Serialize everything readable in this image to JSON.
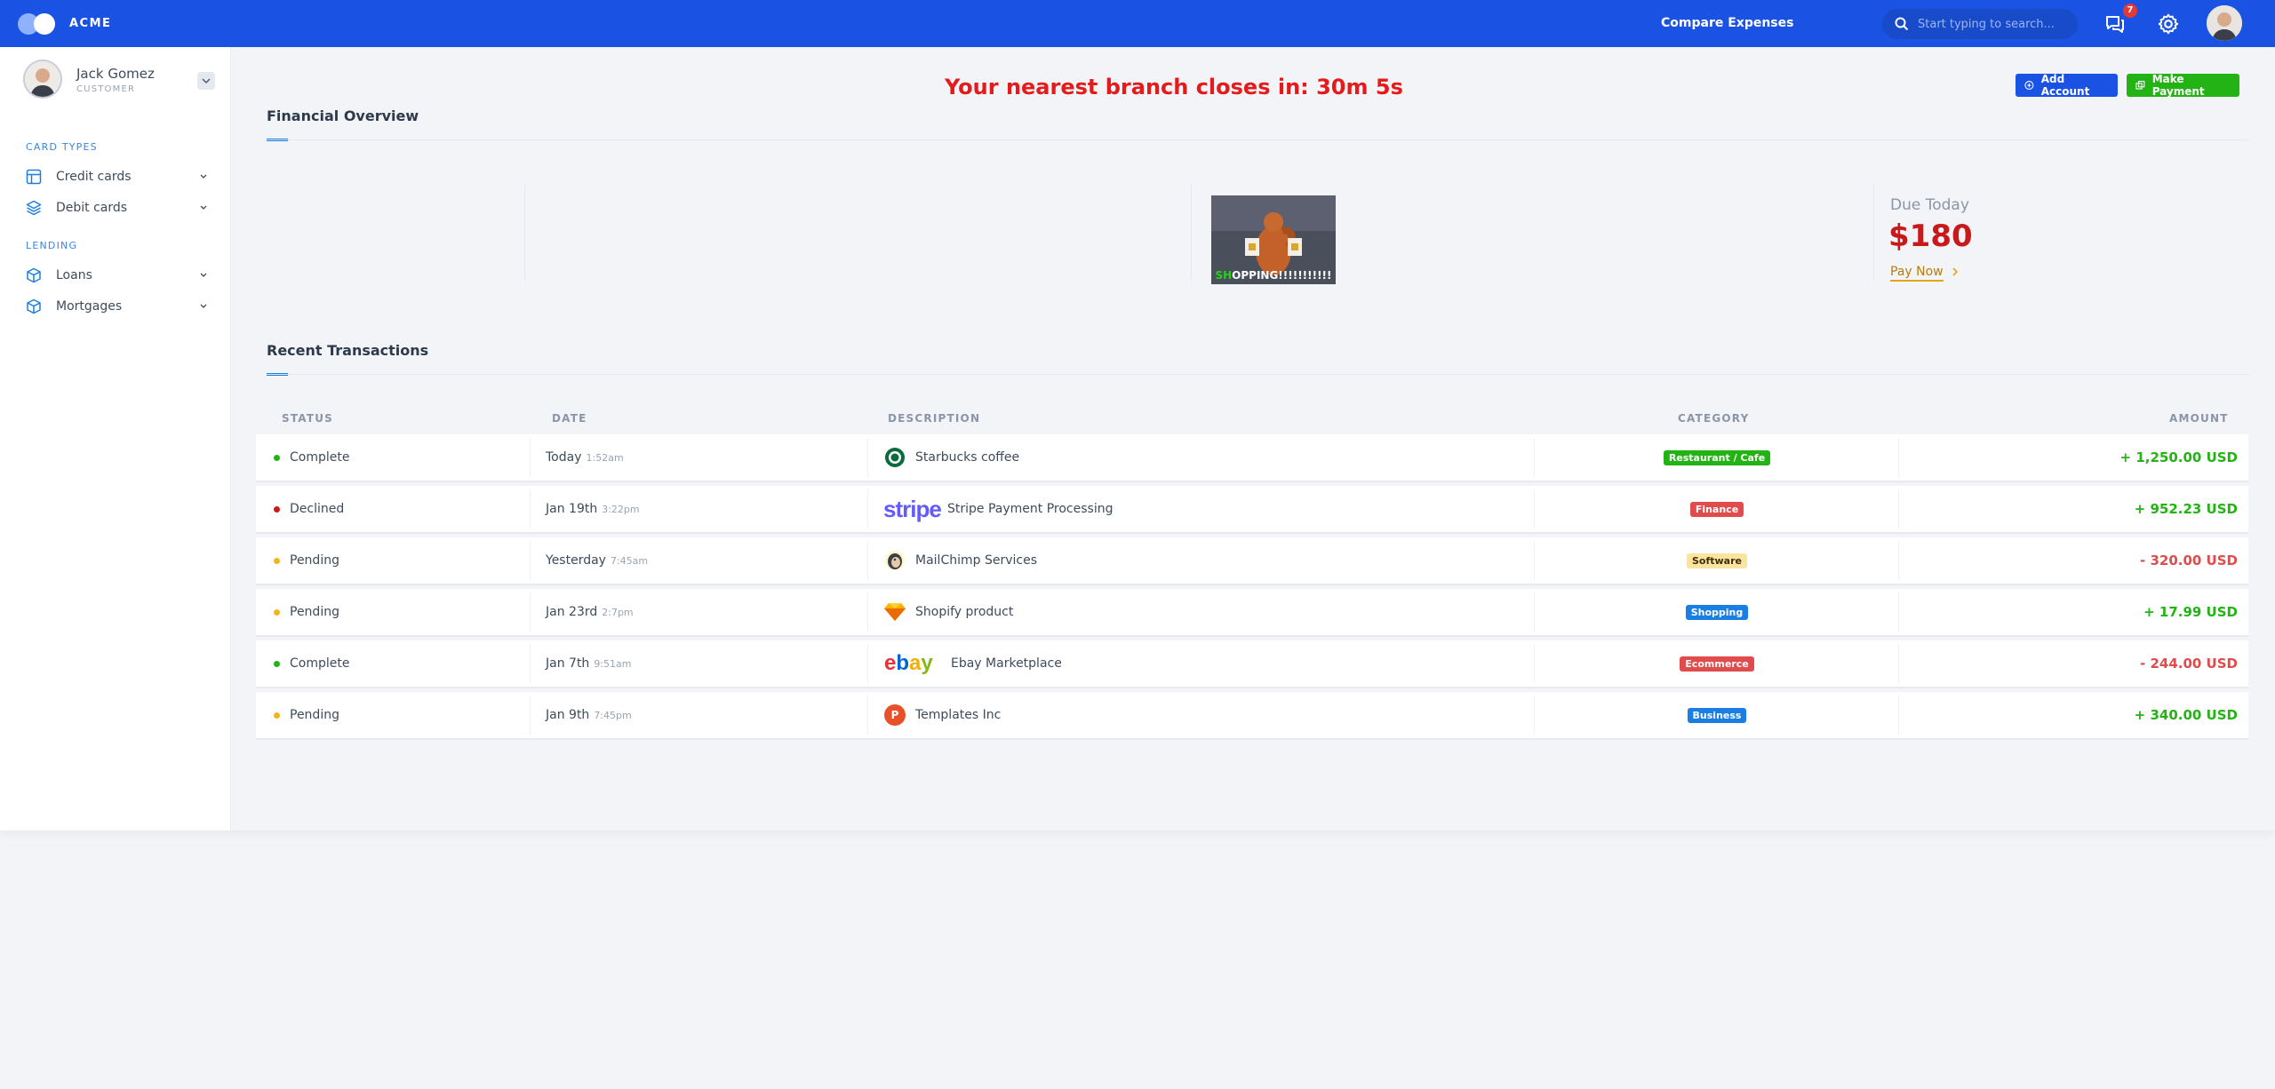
{
  "brand": {
    "name": "ACME"
  },
  "topbar": {
    "compare_label": "Compare Expenses",
    "search_placeholder": "Start typing to search...",
    "notifications_count": "7"
  },
  "user": {
    "name": "Jack Gomez",
    "role": "CUSTOMER"
  },
  "sidebar": {
    "sections": [
      {
        "heading": "CARD TYPES",
        "items": [
          {
            "label": "Credit cards",
            "icon": "layout-icon"
          },
          {
            "label": "Debit cards",
            "icon": "layers-icon"
          }
        ]
      },
      {
        "heading": "LENDING",
        "items": [
          {
            "label": "Loans",
            "icon": "box-icon"
          },
          {
            "label": "Mortgages",
            "icon": "box-icon"
          }
        ]
      }
    ]
  },
  "main": {
    "countdown": "Your nearest branch closes in: 30m 5s",
    "add_account_label": "Add Account",
    "make_payment_label": "Make Payment",
    "financial_overview_title": "Financial Overview",
    "shopping_caption_prefix": "SH",
    "shopping_caption_rest": "OPPING!!!!!!!!!!!",
    "due_label": "Due Today",
    "due_amount": "$180",
    "pay_now_label": "Pay Now",
    "recent_transactions_title": "Recent Transactions"
  },
  "table": {
    "headers": [
      "STATUS",
      "DATE",
      "DESCRIPTION",
      "CATEGORY",
      "AMOUNT"
    ],
    "rows": [
      {
        "status": "Complete",
        "status_color": "#24b314",
        "date": "Today",
        "time": "1:52am",
        "logo": "starbucks-logo",
        "description": "Starbucks coffee",
        "category": "Restaurant / Cafe",
        "category_color": "#24b314",
        "category_text": "#ffffff",
        "amount": "+ 1,250.00 USD",
        "amount_color": "#24b314"
      },
      {
        "status": "Declined",
        "status_color": "#c81a1a",
        "date": "Jan 19th",
        "time": "3:22pm",
        "logo": "stripe-logo",
        "logo_text": "stripe",
        "description": "Stripe Payment Processing",
        "category": "Finance",
        "category_color": "#e04b4b",
        "category_text": "#ffffff",
        "amount": "+ 952.23 USD",
        "amount_color": "#24b314"
      },
      {
        "status": "Pending",
        "status_color": "#f1b51c",
        "date": "Yesterday",
        "time": "7:45am",
        "logo": "mailchimp-logo",
        "description": "MailChimp Services",
        "category": "Software",
        "category_color": "#fbe4a0",
        "category_text": "#3e2f08",
        "amount": "- 320.00 USD",
        "amount_color": "#e04b4b"
      },
      {
        "status": "Pending",
        "status_color": "#f1b51c",
        "date": "Jan 23rd",
        "time": "2:7pm",
        "logo": "sketch-logo",
        "description": "Shopify product",
        "category": "Shopping",
        "category_color": "#1a7ee3",
        "category_text": "#ffffff",
        "amount": "+ 17.99 USD",
        "amount_color": "#24b314"
      },
      {
        "status": "Complete",
        "status_color": "#24b314",
        "date": "Jan 7th",
        "time": "9:51am",
        "logo": "ebay-logo",
        "description": "Ebay Marketplace",
        "category": "Ecommerce",
        "category_color": "#e04b4b",
        "category_text": "#ffffff",
        "amount": "- 244.00 USD",
        "amount_color": "#e04b4b"
      },
      {
        "status": "Pending",
        "status_color": "#f1b51c",
        "date": "Jan 9th",
        "time": "7:45pm",
        "logo": "templates-logo",
        "logo_text": "P",
        "description": "Templates Inc",
        "category": "Business",
        "category_color": "#1a7ee3",
        "category_text": "#ffffff",
        "amount": "+ 340.00 USD",
        "amount_color": "#24b314"
      }
    ]
  }
}
